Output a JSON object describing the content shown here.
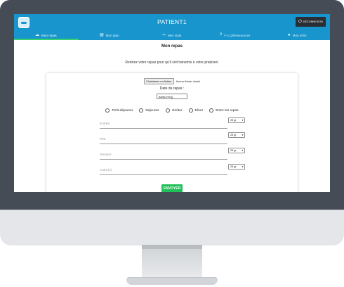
{
  "app": {
    "title": "PATIENT1",
    "logout_label": "DÉCONNEXION",
    "logo_icon": "app-logo",
    "logout_icon": "power-icon"
  },
  "nav": {
    "tabs": [
      {
        "label": "Mon repas",
        "icon": "cloud-upload-icon",
        "active": true
      },
      {
        "label": "Mon plan",
        "icon": "document-icon",
        "active": false
      },
      {
        "label": "Mes stats",
        "icon": "trend-icon",
        "active": false
      },
      {
        "label": "F.A.Q/Ressources",
        "icon": "help-icon",
        "active": false
      },
      {
        "label": "Mon infos",
        "icon": "user-icon",
        "active": false
      }
    ]
  },
  "page": {
    "title": "Mon repas",
    "intro": "Rentrez votre repas pour qu'il soit transmis à votre praticien.",
    "file_button": "Choisissez un fichier",
    "file_status": "Aucun fichier choisi",
    "date_label": "Date du repas :",
    "date_placeholder": "aaaa-mm-jj",
    "meal_types": [
      "Petit-déjeuner",
      "Déjeuner",
      "Goûter",
      "Dîner",
      "Entre les repas"
    ],
    "fields": [
      {
        "placeholder": "Entrée",
        "qty": "25 gr"
      },
      {
        "placeholder": "Plat",
        "qty": "25 gr"
      },
      {
        "placeholder": "Dessert",
        "qty": "25 gr"
      },
      {
        "placeholder": "Autre(s)",
        "qty": "25 gr"
      }
    ],
    "submit_label": "ENVOYER"
  },
  "colors": {
    "topbar": "#1795cc",
    "active_indicator": "#37d26f",
    "submit": "#22c05a",
    "monitor": "#454c55"
  }
}
